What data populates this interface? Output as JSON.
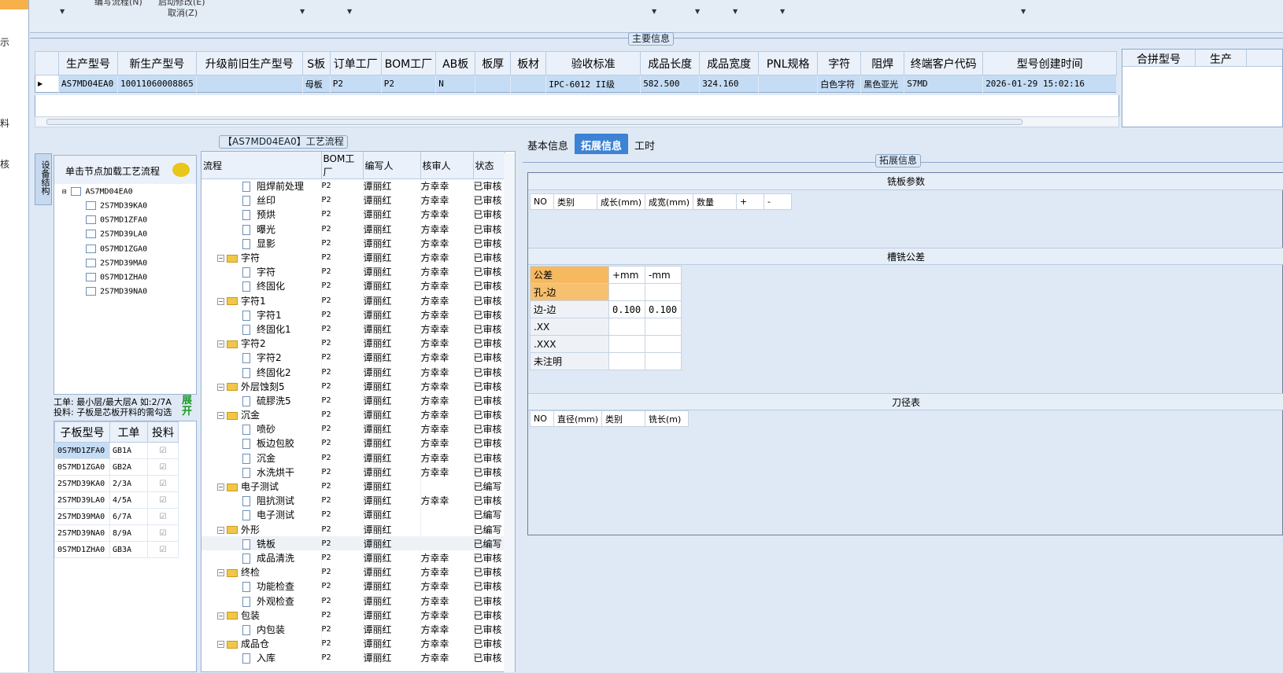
{
  "top_menu": {
    "item1": "编写流程(N)",
    "item2": "启动修改(E)",
    "item3": "取消(Z)"
  },
  "left_strip": [
    "示",
    "料",
    "核"
  ],
  "main_info": {
    "title": "主要信息",
    "columns": [
      "生产型号",
      "新生产型号",
      "升级前旧生产型号",
      "S板",
      "订单工厂",
      "BOM工厂",
      "AB板",
      "板厚",
      "板材",
      "验收标准",
      "成品长度",
      "成品宽度",
      "PNL规格",
      "字符",
      "阻焊",
      "终端客户代码",
      "型号创建时间"
    ],
    "row": [
      "AS7MD04EA0",
      "10011060008865",
      "",
      "母板",
      "P2",
      "P2",
      "N",
      "",
      "",
      "IPC-6012 II级",
      "582.500",
      "324.160",
      "",
      "白色字符",
      "黑色亚光",
      "S7MD",
      "2026-01-29 15:02:16"
    ]
  },
  "merge_grid": {
    "columns": [
      "合拼型号",
      "生产"
    ]
  },
  "flow_panel": {
    "title": "【AS7MD04EA0】工艺流程"
  },
  "vertical_tab": "设备结构",
  "tree": {
    "header": "单击节点加载工艺流程",
    "root": "AS7MD04EA0",
    "children": [
      "2S7MD39KA0",
      "0S7MD1ZFA0",
      "2S7MD39LA0",
      "0S7MD1ZGA0",
      "2S7MD39MA0",
      "0S7MD1ZHA0",
      "2S7MD39NA0"
    ]
  },
  "info_text": {
    "line1": "工单: 最小层/最大层A 如:2/7A",
    "line2": "投料: 子板是芯板开料的需勾选",
    "expand": "展开"
  },
  "sub_grid": {
    "columns": [
      "子板型号",
      "工单",
      "投料"
    ],
    "rows": [
      [
        "0S7MD1ZFA0",
        "GB1A"
      ],
      [
        "0S7MD1ZGA0",
        "GB2A"
      ],
      [
        "2S7MD39KA0",
        "2/3A"
      ],
      [
        "2S7MD39LA0",
        "4/5A"
      ],
      [
        "2S7MD39MA0",
        "6/7A"
      ],
      [
        "2S7MD39NA0",
        "8/9A"
      ],
      [
        "0S7MD1ZHA0",
        "GB3A"
      ]
    ]
  },
  "flow_grid": {
    "columns": [
      "流程",
      "BOM工厂",
      "编写人",
      "核审人",
      "状态"
    ],
    "rows": [
      {
        "name": "阻焊前处理",
        "type": "doc",
        "bom": "P2",
        "writer": "谭丽红",
        "reviewer": "方幸幸",
        "status": "已审核"
      },
      {
        "name": "丝印",
        "type": "doc",
        "bom": "P2",
        "writer": "谭丽红",
        "reviewer": "方幸幸",
        "status": "已审核"
      },
      {
        "name": "预烘",
        "type": "doc",
        "bom": "P2",
        "writer": "谭丽红",
        "reviewer": "方幸幸",
        "status": "已审核"
      },
      {
        "name": "曝光",
        "type": "doc",
        "bom": "P2",
        "writer": "谭丽红",
        "reviewer": "方幸幸",
        "status": "已审核"
      },
      {
        "name": "显影",
        "type": "doc",
        "bom": "P2",
        "writer": "谭丽红",
        "reviewer": "方幸幸",
        "status": "已审核"
      },
      {
        "name": "字符",
        "type": "folder",
        "bom": "P2",
        "writer": "谭丽红",
        "reviewer": "方幸幸",
        "status": "已审核"
      },
      {
        "name": "字符",
        "type": "doc",
        "bom": "P2",
        "writer": "谭丽红",
        "reviewer": "方幸幸",
        "status": "已审核"
      },
      {
        "name": "终固化",
        "type": "doc",
        "bom": "P2",
        "writer": "谭丽红",
        "reviewer": "方幸幸",
        "status": "已审核"
      },
      {
        "name": "字符1",
        "type": "folder",
        "bom": "P2",
        "writer": "谭丽红",
        "reviewer": "方幸幸",
        "status": "已审核"
      },
      {
        "name": "字符1",
        "type": "doc",
        "bom": "P2",
        "writer": "谭丽红",
        "reviewer": "方幸幸",
        "status": "已审核"
      },
      {
        "name": "终固化1",
        "type": "doc",
        "bom": "P2",
        "writer": "谭丽红",
        "reviewer": "方幸幸",
        "status": "已审核"
      },
      {
        "name": "字符2",
        "type": "folder",
        "bom": "P2",
        "writer": "谭丽红",
        "reviewer": "方幸幸",
        "status": "已审核"
      },
      {
        "name": "字符2",
        "type": "doc",
        "bom": "P2",
        "writer": "谭丽红",
        "reviewer": "方幸幸",
        "status": "已审核"
      },
      {
        "name": "终固化2",
        "type": "doc",
        "bom": "P2",
        "writer": "谭丽红",
        "reviewer": "方幸幸",
        "status": "已审核"
      },
      {
        "name": "外层蚀刻5",
        "type": "folder",
        "bom": "P2",
        "writer": "谭丽红",
        "reviewer": "方幸幸",
        "status": "已审核"
      },
      {
        "name": "硫膠洗5",
        "type": "doc",
        "bom": "P2",
        "writer": "谭丽红",
        "reviewer": "方幸幸",
        "status": "已审核"
      },
      {
        "name": "沉金",
        "type": "folder",
        "bom": "P2",
        "writer": "谭丽红",
        "reviewer": "方幸幸",
        "status": "已审核"
      },
      {
        "name": "喷砂",
        "type": "doc",
        "bom": "P2",
        "writer": "谭丽红",
        "reviewer": "方幸幸",
        "status": "已审核"
      },
      {
        "name": "板边包胶",
        "type": "doc",
        "bom": "P2",
        "writer": "谭丽红",
        "reviewer": "方幸幸",
        "status": "已审核"
      },
      {
        "name": "沉金",
        "type": "doc",
        "bom": "P2",
        "writer": "谭丽红",
        "reviewer": "方幸幸",
        "status": "已审核"
      },
      {
        "name": "水洗烘干",
        "type": "doc",
        "bom": "P2",
        "writer": "谭丽红",
        "reviewer": "方幸幸",
        "status": "已审核"
      },
      {
        "name": "电子测试",
        "type": "folder",
        "bom": "P2",
        "writer": "谭丽红",
        "reviewer": "",
        "status": "已编写"
      },
      {
        "name": "阻抗测试",
        "type": "doc",
        "bom": "P2",
        "writer": "谭丽红",
        "reviewer": "方幸幸",
        "status": "已审核"
      },
      {
        "name": "电子测试",
        "type": "doc",
        "bom": "P2",
        "writer": "谭丽红",
        "reviewer": "",
        "status": "已编写"
      },
      {
        "name": "外形",
        "type": "folder",
        "bom": "P2",
        "writer": "谭丽红",
        "reviewer": "",
        "status": "已编写"
      },
      {
        "name": "铣板",
        "type": "doc",
        "bom": "P2",
        "writer": "谭丽红",
        "reviewer": "",
        "status": "已编写"
      },
      {
        "name": "成品清洗",
        "type": "doc",
        "bom": "P2",
        "writer": "谭丽红",
        "reviewer": "方幸幸",
        "status": "已审核"
      },
      {
        "name": "终检",
        "type": "folder",
        "bom": "P2",
        "writer": "谭丽红",
        "reviewer": "方幸幸",
        "status": "已审核"
      },
      {
        "name": "功能检查",
        "type": "doc",
        "bom": "P2",
        "writer": "谭丽红",
        "reviewer": "方幸幸",
        "status": "已审核"
      },
      {
        "name": "外观检查",
        "type": "doc",
        "bom": "P2",
        "writer": "谭丽红",
        "reviewer": "方幸幸",
        "status": "已审核"
      },
      {
        "name": "包装",
        "type": "folder",
        "bom": "P2",
        "writer": "谭丽红",
        "reviewer": "方幸幸",
        "status": "已审核"
      },
      {
        "name": "内包装",
        "type": "doc",
        "bom": "P2",
        "writer": "谭丽红",
        "reviewer": "方幸幸",
        "status": "已审核"
      },
      {
        "name": "成品仓",
        "type": "folder",
        "bom": "P2",
        "writer": "谭丽红",
        "reviewer": "方幸幸",
        "status": "已审核"
      },
      {
        "name": "入库",
        "type": "doc",
        "bom": "P2",
        "writer": "谭丽红",
        "reviewer": "方幸幸",
        "status": "已审核"
      }
    ]
  },
  "right_tabs": [
    "基本信息",
    "拓展信息",
    "工时"
  ],
  "ext_info": {
    "title": "拓展信息",
    "milling_params": {
      "title": "铣板参数",
      "columns": [
        "NO",
        "类别",
        "成长(mm)",
        "成宽(mm)",
        "数量",
        "+",
        "-"
      ]
    },
    "tolerance": {
      "title": "槽铣公差",
      "columns": [
        "公差",
        "+mm",
        "-mm"
      ],
      "rows": [
        [
          "孔-边",
          "",
          ""
        ],
        [
          "边-边",
          "0.100",
          "0.100"
        ],
        [
          ".XX",
          "",
          ""
        ],
        [
          ".XXX",
          "",
          ""
        ],
        [
          "未注明",
          "",
          ""
        ]
      ]
    },
    "tool_table": {
      "title": "刀径表",
      "columns": [
        "NO",
        "直径(mm)",
        "类别",
        "铣长(m)"
      ]
    }
  },
  "colors": {
    "accent": "#3d82d4",
    "selected_row": "#c5dcf5",
    "folder": "#f2c649",
    "highlight": "#f6b960"
  }
}
